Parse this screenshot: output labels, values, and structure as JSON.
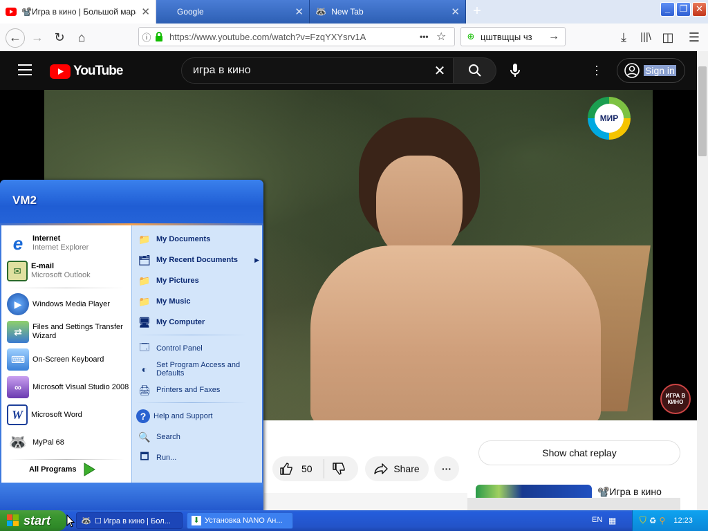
{
  "browser": {
    "tabs": [
      {
        "title": "📽️Игра в кино | Большой мараф",
        "active": true
      },
      {
        "title": "Google",
        "active": false
      },
      {
        "title": "New Tab",
        "active": false
      }
    ],
    "url": "https://www.youtube.com/watch?v=FzqYXYsrv1A",
    "search_value": "цштвщцы чз"
  },
  "youtube": {
    "logo_text": "YouTube",
    "search_query": "игра в кино",
    "sign_in_label": "Sign in",
    "channel_bug": "МИР",
    "watermark": "ИГРА В КИНО",
    "like_count": "50",
    "share_label": "Share",
    "chat_replay_label": "Show chat replay",
    "related_title": "📽️Игра в кино"
  },
  "start_menu": {
    "user": "VM2",
    "pinned": [
      {
        "name": "Internet",
        "sub": "Internet Explorer"
      },
      {
        "name": "E-mail",
        "sub": "Microsoft Outlook"
      }
    ],
    "recent": [
      "Windows Media Player",
      "Files and Settings Transfer Wizard",
      "On-Screen Keyboard",
      "Microsoft Visual Studio 2008",
      "Microsoft Word",
      "MyPal 68"
    ],
    "all_programs": "All Programs",
    "places": [
      "My Documents",
      "My Recent Documents",
      "My Pictures",
      "My Music",
      "My Computer"
    ],
    "system": [
      "Control Panel",
      "Set Program Access and Defaults",
      "Printers and Faxes"
    ],
    "help": [
      "Help and Support",
      "Search",
      "Run..."
    ]
  },
  "taskbar": {
    "start_label": "start",
    "tasks": [
      "☐ Игра в кино | Бол...",
      "Установка NANO Ан..."
    ],
    "language": "EN",
    "clock": "12:23"
  },
  "colors": {
    "youtube_red": "#ff0000",
    "xp_blue": "#245ddb",
    "start_green": "#3a9630"
  }
}
